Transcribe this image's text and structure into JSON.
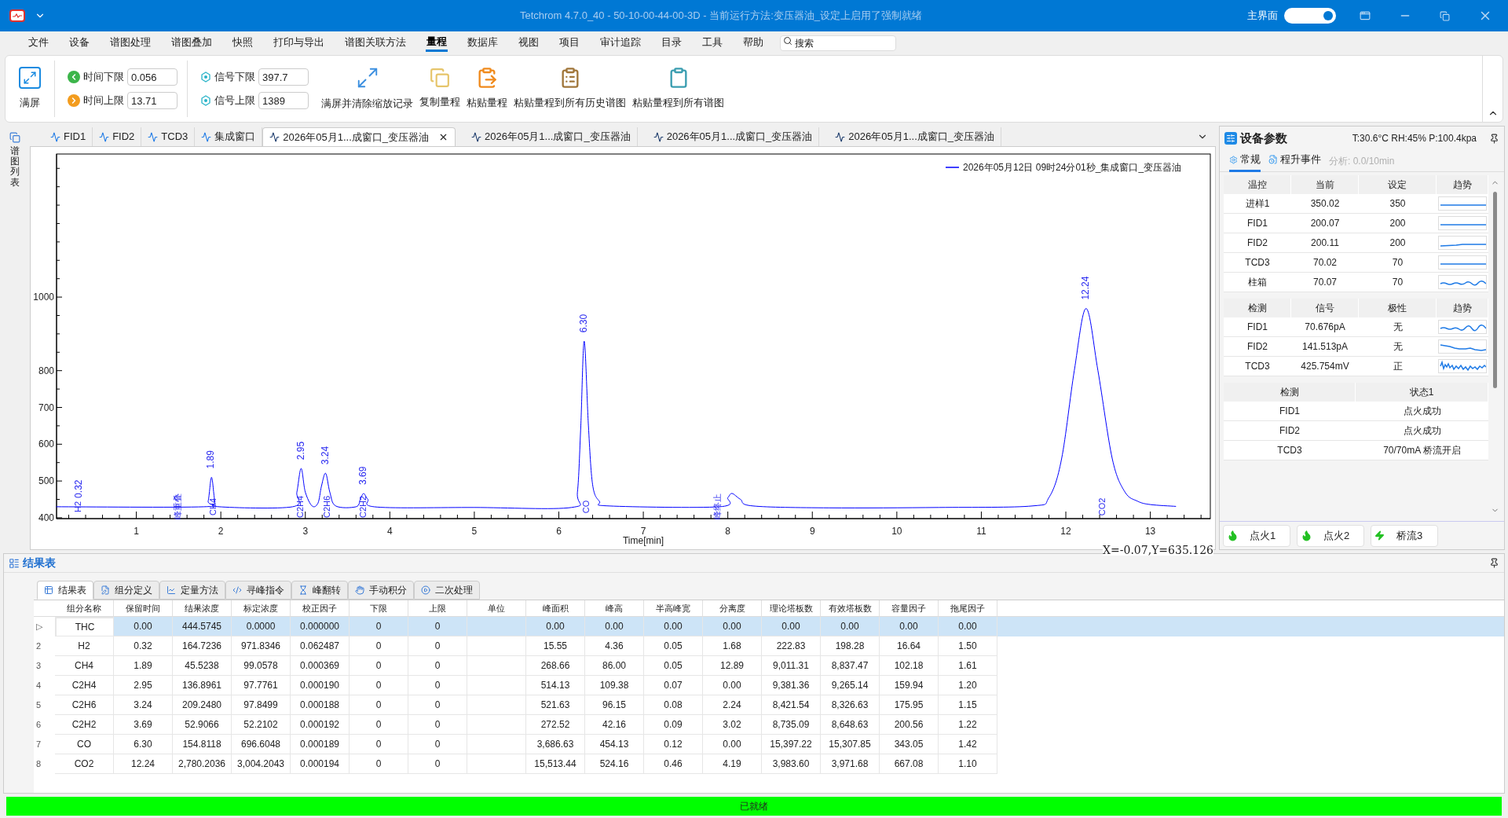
{
  "window": {
    "title": "Tetchrom 4.7.0_40 - 50-10-00-44-00-3D - 当前运行方法:变压器油_设定上启用了强制就绪",
    "main_view": {
      "label": "主界面",
      "on": true
    }
  },
  "menu": [
    {
      "label": "文件",
      "selected": false
    },
    {
      "label": "设备",
      "selected": false
    },
    {
      "label": "谱图处理",
      "selected": false
    },
    {
      "label": "谱图叠加",
      "selected": false
    },
    {
      "label": "快照",
      "selected": false
    },
    {
      "label": "打印与导出",
      "selected": false
    },
    {
      "label": "谱图关联方法",
      "selected": false
    },
    {
      "label": "量程",
      "selected": true
    },
    {
      "label": "数据库",
      "selected": false
    },
    {
      "label": "视图",
      "selected": false
    },
    {
      "label": "项目",
      "selected": false
    },
    {
      "label": "审计追踪",
      "selected": false
    },
    {
      "label": "目录",
      "selected": false
    },
    {
      "label": "工具",
      "selected": false
    },
    {
      "label": "帮助",
      "selected": false
    }
  ],
  "search": {
    "placeholder": "搜索"
  },
  "toolbar": {
    "fullscreen": "满屏",
    "ranges": [
      {
        "kind": "time_low",
        "label": "时间下限",
        "value": "0.056"
      },
      {
        "kind": "time_high",
        "label": "时间上限",
        "value": "13.71"
      },
      {
        "kind": "signal_low",
        "label": "信号下限",
        "value": "397.7"
      },
      {
        "kind": "signal_high",
        "label": "信号上限",
        "value": "1389"
      }
    ],
    "actions": [
      {
        "kind": "expand",
        "label": "满屏并清除缩放记录"
      },
      {
        "kind": "copy",
        "label": "复制量程"
      },
      {
        "kind": "paste",
        "label": "粘贴量程"
      },
      {
        "kind": "paste_history",
        "label": "粘贴量程到所有历史谱图"
      },
      {
        "kind": "paste_all",
        "label": "粘贴量程到所有谱图"
      }
    ]
  },
  "side_panel": {
    "label": "谱图列表"
  },
  "chart_tabs": [
    {
      "label": "FID1",
      "selected": false
    },
    {
      "label": "FID2",
      "selected": false
    },
    {
      "label": "TCD3",
      "selected": false
    },
    {
      "label": "集成窗口",
      "selected": false
    },
    {
      "label": "2026年05月1...成窗口_变压器油",
      "selected": true
    },
    {
      "label": "2026年05月1...成窗口_变压器油",
      "selected": false
    },
    {
      "label": "2026年05月1...成窗口_变压器油",
      "selected": false
    },
    {
      "label": "2026年05月1...成窗口_变压器油",
      "selected": false
    }
  ],
  "chart": {
    "readout": "X=-0.07,Y=635.126",
    "chart_data": {
      "type": "line",
      "xlabel": "Time[min]",
      "xlim": [
        0.056,
        13.71
      ],
      "ylim": [
        397.7,
        1389
      ],
      "xticks": [
        1,
        2,
        3,
        4,
        5,
        6,
        7,
        8,
        9,
        10,
        11,
        12,
        13
      ],
      "yticks": [
        400,
        500,
        600,
        700,
        800,
        1000
      ],
      "x": [
        0.056,
        1.8,
        1.85,
        1.89,
        1.93,
        1.98,
        2.85,
        2.9,
        2.95,
        3.0,
        3.08,
        3.15,
        3.19,
        3.24,
        3.29,
        3.36,
        3.6,
        3.65,
        3.69,
        3.74,
        3.85,
        5.0,
        6.15,
        6.22,
        6.26,
        6.3,
        6.35,
        6.4,
        6.48,
        6.6,
        7.9,
        8.0,
        8.05,
        8.15,
        8.3,
        9.2,
        10.5,
        11.6,
        11.8,
        11.95,
        12.1,
        12.24,
        12.38,
        12.55,
        12.7,
        12.85,
        13.0,
        13.3
      ],
      "series": [
        {
          "name": "2026年05月12日 09时24分01秒_集成窗口_变压器油",
          "color": "#0000ff",
          "values": [
            430,
            430,
            445,
            510,
            445,
            430,
            430,
            470,
            534,
            470,
            432,
            440,
            485,
            521,
            470,
            432,
            430,
            450,
            466,
            450,
            429,
            428,
            428,
            470,
            650,
            880,
            650,
            490,
            445,
            432,
            430,
            455,
            466,
            450,
            432,
            427,
            428,
            432,
            455,
            560,
            800,
            969,
            800,
            560,
            470,
            445,
            436,
            431
          ]
        }
      ],
      "annotations": [
        {
          "x": 0.32,
          "y": 430,
          "text": "0.32"
        },
        "H2",
        "峰重叠",
        {
          "x": 1.89,
          "y": 510,
          "text": "1.89"
        },
        "CH4",
        {
          "x": 2.95,
          "y": 534,
          "text": "2.95"
        },
        "C2H4",
        {
          "x": 3.24,
          "y": 521,
          "text": "3.24"
        },
        "C2H6",
        {
          "x": 3.69,
          "y": 466,
          "text": "3.69"
        },
        "C2H2",
        {
          "x": 6.3,
          "y": 880,
          "text": "6.30"
        },
        "CO",
        "峰终止",
        {
          "x": 12.24,
          "y": 969,
          "text": "12.24"
        },
        "CO2"
      ]
    }
  },
  "device_panel": {
    "title": "设备参数",
    "conditions": "T:30.6°C RH:45% P:100.4kpa",
    "tabs": [
      {
        "label": "常规",
        "selected": true
      },
      {
        "label": "程升事件",
        "selected": false
      }
    ],
    "analysis": {
      "text": "分析: 0.0/10min",
      "disabled": true
    },
    "temperature_table": {
      "columns": [
        "温控",
        "当前",
        "设定",
        "趋势"
      ],
      "rows": [
        {
          "name": "进样1",
          "current": "350.02",
          "setpoint": "350"
        },
        {
          "name": "FID1",
          "current": "200.07",
          "setpoint": "200"
        },
        {
          "name": "FID2",
          "current": "200.11",
          "setpoint": "200"
        },
        {
          "name": "TCD3",
          "current": "70.02",
          "setpoint": "70"
        },
        {
          "name": "柱箱",
          "current": "70.07",
          "setpoint": "70"
        }
      ]
    },
    "detector_table": {
      "columns": [
        "检测",
        "信号",
        "极性",
        "趋势"
      ],
      "rows": [
        {
          "name": "FID1",
          "signal": "70.676pA",
          "polarity": "无"
        },
        {
          "name": "FID2",
          "signal": "141.513pA",
          "polarity": "无"
        },
        {
          "name": "TCD3",
          "signal": "425.754mV",
          "polarity": "正"
        }
      ]
    },
    "status_table": {
      "columns": [
        "检测",
        "状态1"
      ],
      "rows": [
        {
          "name": "FID1",
          "status": "点火成功"
        },
        {
          "name": "FID2",
          "status": "点火成功"
        },
        {
          "name": "TCD3",
          "status": "70/70mA 桥流开启"
        }
      ]
    },
    "buttons": [
      {
        "kind": "ignite",
        "label": "点火1"
      },
      {
        "kind": "ignite",
        "label": "点火2"
      },
      {
        "kind": "bridge",
        "label": "桥流3"
      }
    ]
  },
  "results": {
    "title": "结果表",
    "tabs": [
      {
        "kind": "table",
        "label": "结果表",
        "selected": true
      },
      {
        "kind": "define",
        "label": "组分定义",
        "selected": false
      },
      {
        "kind": "quant",
        "label": "定量方法",
        "selected": false
      },
      {
        "kind": "code",
        "label": "寻峰指令",
        "selected": false
      },
      {
        "kind": "flip",
        "label": "峰翻转",
        "selected": false
      },
      {
        "kind": "manual",
        "label": "手动积分",
        "selected": false
      },
      {
        "kind": "play",
        "label": "二次处理",
        "selected": false
      }
    ],
    "columns": [
      "组分名称",
      "保留时间",
      "结果浓度",
      "标定浓度",
      "校正因子",
      "下限",
      "上限",
      "单位",
      "峰面积",
      "峰高",
      "半高峰宽",
      "分离度",
      "理论塔板数",
      "有效塔板数",
      "容量因子",
      "拖尾因子"
    ],
    "rows": [
      {
        "header": "▷",
        "selected": true,
        "cells": [
          "THC",
          "0.00",
          "444.5745",
          "0.0000",
          "0.000000",
          "0",
          "0",
          null,
          "0.00",
          "0.00",
          "0.00",
          "0.00",
          "0.00",
          "0.00",
          "0.00",
          "0.00"
        ]
      },
      {
        "header": "2",
        "selected": false,
        "cells": [
          "H2",
          "0.32",
          "164.7236",
          "971.8346",
          "0.062487",
          "0",
          "0",
          null,
          "15.55",
          "4.36",
          "0.05",
          "1.68",
          "222.83",
          "198.28",
          "16.64",
          "1.50"
        ]
      },
      {
        "header": "3",
        "selected": false,
        "cells": [
          "CH4",
          "1.89",
          "45.5238",
          "99.0578",
          "0.000369",
          "0",
          "0",
          null,
          "268.66",
          "86.00",
          "0.05",
          "12.89",
          "9,011.31",
          "8,837.47",
          "102.18",
          "1.61"
        ]
      },
      {
        "header": "4",
        "selected": false,
        "cells": [
          "C2H4",
          "2.95",
          "136.8961",
          "97.7761",
          "0.000190",
          "0",
          "0",
          null,
          "514.13",
          "109.38",
          "0.07",
          "0.00",
          "9,381.36",
          "9,265.14",
          "159.94",
          "1.20"
        ]
      },
      {
        "header": "5",
        "selected": false,
        "cells": [
          "C2H6",
          "3.24",
          "209.2480",
          "97.8499",
          "0.000188",
          "0",
          "0",
          null,
          "521.63",
          "96.15",
          "0.08",
          "2.24",
          "8,421.54",
          "8,326.63",
          "175.95",
          "1.15"
        ]
      },
      {
        "header": "6",
        "selected": false,
        "cells": [
          "C2H2",
          "3.69",
          "52.9066",
          "52.2102",
          "0.000192",
          "0",
          "0",
          null,
          "272.52",
          "42.16",
          "0.09",
          "3.02",
          "8,735.09",
          "8,648.63",
          "200.56",
          "1.22"
        ]
      },
      {
        "header": "7",
        "selected": false,
        "cells": [
          "CO",
          "6.30",
          "154.8118",
          "696.6048",
          "0.000189",
          "0",
          "0",
          null,
          "3,686.63",
          "454.13",
          "0.12",
          "0.00",
          "15,397.22",
          "15,307.85",
          "343.05",
          "1.42"
        ]
      },
      {
        "header": "8",
        "selected": false,
        "cells": [
          "CO2",
          "12.24",
          "2,780.2036",
          "3,004.2043",
          "0.000194",
          "0",
          "0",
          null,
          "15,513.44",
          "524.16",
          "0.46",
          "4.19",
          "3,983.60",
          "3,971.68",
          "667.08",
          "1.10"
        ]
      }
    ]
  },
  "status_bar": {
    "text": "已就绪"
  }
}
